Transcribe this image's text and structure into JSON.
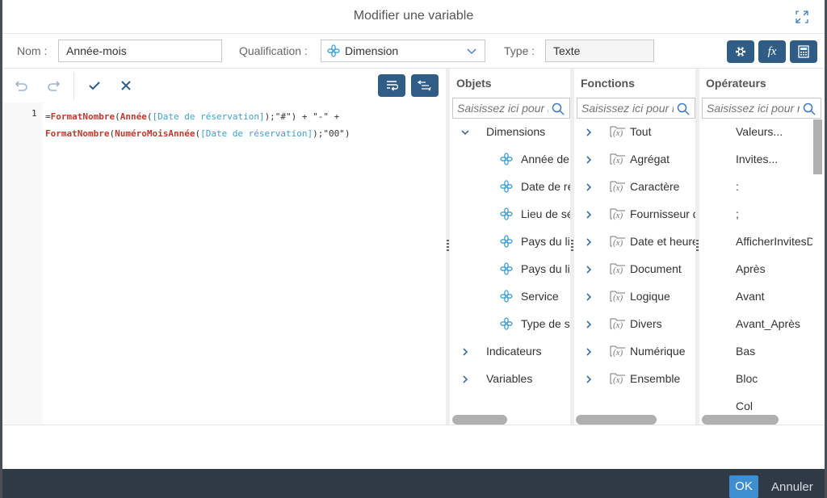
{
  "dialog": {
    "title": "Modifier une variable",
    "expand_icon": "expand-icon"
  },
  "properties": {
    "name_label": "Nom :",
    "name_value": "Année-mois",
    "qualification_label": "Qualification :",
    "qualification_value": "Dimension",
    "qualification_icon": "dimension-icon",
    "type_label": "Type :",
    "type_value": "Texte",
    "toolbar_buttons": [
      "objects-icon",
      "function-icon",
      "calculator-icon"
    ]
  },
  "editor": {
    "toolbar": [
      "undo-icon",
      "redo-icon",
      "validate-icon",
      "clear-icon",
      "wrap-text-icon",
      "format-icon"
    ],
    "line_number": "1",
    "formula_line1": [
      {
        "t": "=",
        "c": "str"
      },
      {
        "t": "FormatNombre",
        "c": "fn"
      },
      {
        "t": "(",
        "c": "str"
      },
      {
        "t": "Année",
        "c": "fn"
      },
      {
        "t": "(",
        "c": "str"
      },
      {
        "t": "[Date de réservation]",
        "c": "ref"
      },
      {
        "t": ");\"#\") + \"-\" +",
        "c": "str"
      }
    ],
    "formula_line2": [
      {
        "t": "FormatNombre",
        "c": "fn"
      },
      {
        "t": "(",
        "c": "str"
      },
      {
        "t": "NuméroMoisAnnée",
        "c": "fn"
      },
      {
        "t": "(",
        "c": "str"
      },
      {
        "t": "[Date de réservation]",
        "c": "ref"
      },
      {
        "t": ");\"00\")",
        "c": "str"
      }
    ]
  },
  "objects": {
    "title": "Objets",
    "search_placeholder": "Saisissez ici pour rechercher",
    "dimensions_label": "Dimensions",
    "dimension_items": [
      "Année de réservation",
      "Date de réservation",
      "Lieu de séjour",
      "Pays du lieu",
      "Pays du lieu",
      "Service",
      "Type de séjour"
    ],
    "indicators_label": "Indicateurs",
    "variables_label": "Variables"
  },
  "functions": {
    "title": "Fonctions",
    "search_placeholder": "Saisissez ici pour rechercher",
    "items": [
      "Tout",
      "Agrégat",
      "Caractère",
      "Fournisseur de données",
      "Date et heure",
      "Document",
      "Logique",
      "Divers",
      "Numérique",
      "Ensemble"
    ]
  },
  "operators": {
    "title": "Opérateurs",
    "search_placeholder": "Saisissez ici pour rechercher",
    "items": [
      "Valeurs...",
      "Invites...",
      ":",
      ";",
      "AfficherInvitesDans",
      "Après",
      "Avant",
      "Avant_Après",
      "Bas",
      "Bloc",
      "Col"
    ]
  },
  "footer": {
    "ok_label": "OK",
    "cancel_label": "Annuler"
  },
  "colors": {
    "accent": "#2f5d85",
    "ok": "#3d8fd1",
    "footer": "#2f3a46",
    "function_text": "#c0392b",
    "reference_text": "#3fa0d0"
  }
}
